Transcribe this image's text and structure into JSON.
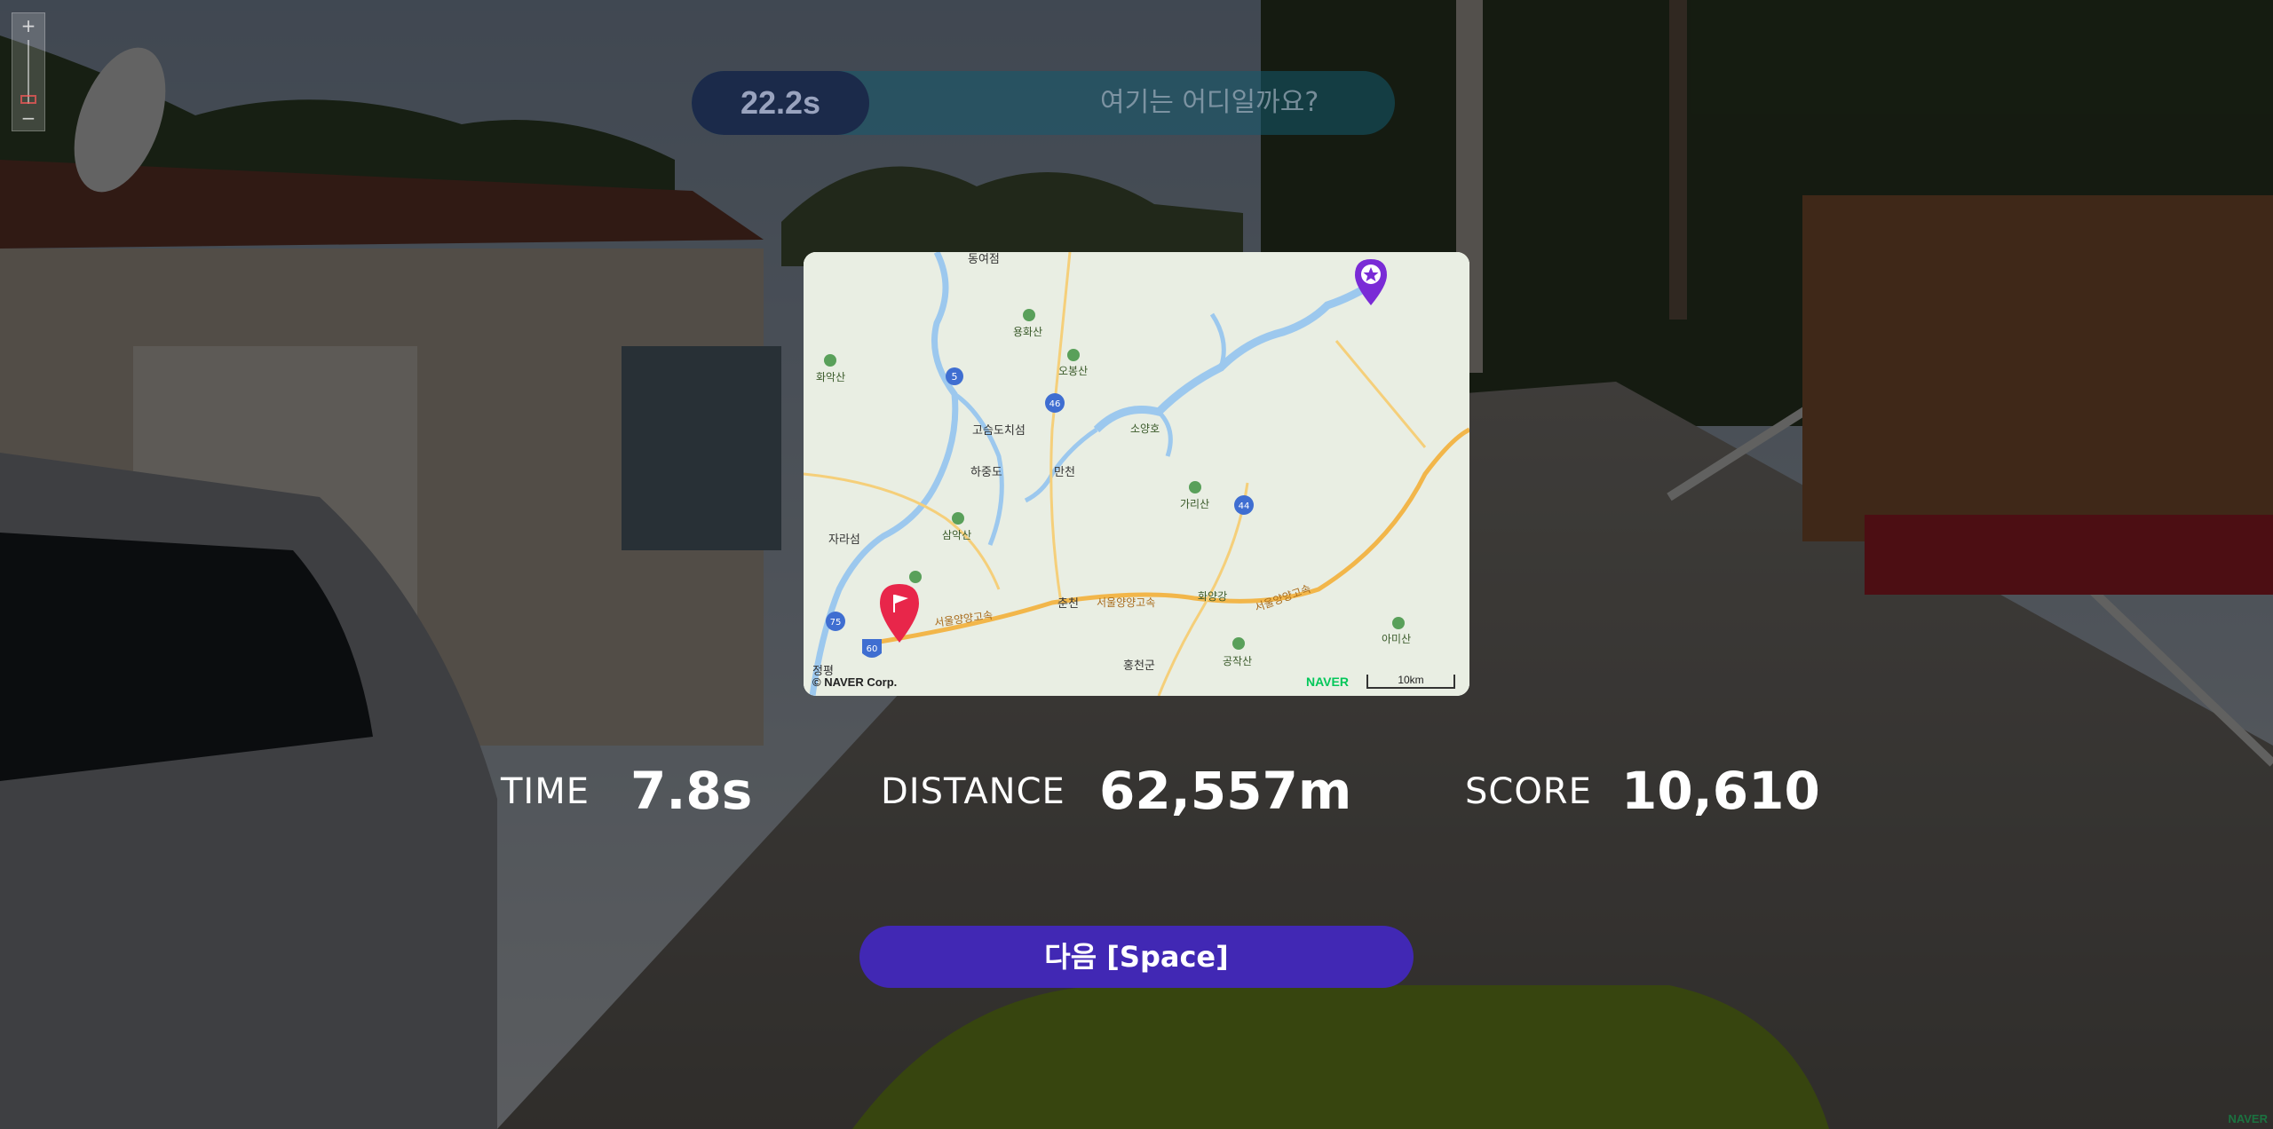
{
  "colors": {
    "accent_button": "#4128b4",
    "timer_bar": "#145a6e",
    "guess_marker": "#e8264a",
    "answer_marker": "#7a2bd6",
    "text": "#ffffff"
  },
  "background": {
    "description_icon": "street-view-panorama"
  },
  "zoom": {
    "zoom_in": "+",
    "zoom_out": "−"
  },
  "timer": {
    "remaining": "22.2s",
    "prompt": "여기는 어디일까요?"
  },
  "map": {
    "labels": [
      "동여점",
      "용화산",
      "화악산",
      "오봉산",
      "소양호",
      "고슴도치섬",
      "하중도",
      "만천",
      "자라섬",
      "삼악산",
      "가리산",
      "서울양양고속",
      "춘천",
      "화양강",
      "서울양양고속",
      "홍천군",
      "공작산",
      "아미산",
      "서울양양고속",
      "정평"
    ],
    "route_numbers": [
      "5",
      "46",
      "44",
      "75",
      "60"
    ],
    "copyright": "© NAVER Corp.",
    "brand": "NAVER",
    "scale": "10km",
    "guess_marker_icon": "flag-pin-icon",
    "answer_marker_icon": "star-pin-icon"
  },
  "stats": {
    "time_label": "TIME",
    "time_value": "7.8s",
    "distance_label": "DISTANCE",
    "distance_value": "62,557m",
    "score_label": "SCORE",
    "score_value": "10,610"
  },
  "next_button": "다음 [Space]",
  "watermark": "NAVER"
}
